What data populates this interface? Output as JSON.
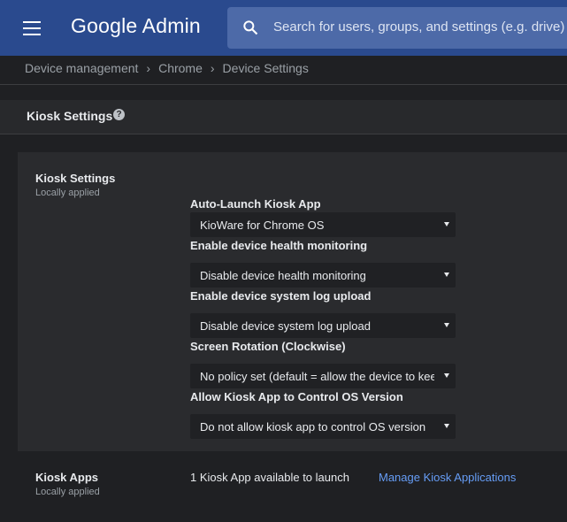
{
  "header": {
    "logo": "Google Admin",
    "search_placeholder": "Search for users, groups, and settings (e.g. drive)"
  },
  "breadcrumb": [
    "Device management",
    "Chrome",
    "Device Settings"
  ],
  "section": {
    "title": "Kiosk Settings"
  },
  "kiosk_settings": {
    "title": "Kiosk Settings",
    "subtitle": "Locally applied",
    "fields": [
      {
        "label": "Auto-Launch Kiosk App",
        "value": "KioWare for Chrome OS"
      },
      {
        "label": "Enable device health monitoring",
        "value": "Disable device health monitoring"
      },
      {
        "label": "Enable device system log upload",
        "value": "Disable device system log upload"
      },
      {
        "label": "Screen Rotation (Clockwise)",
        "value": "No policy set (default = allow the device to keep"
      },
      {
        "label": "Allow Kiosk App to Control OS Version",
        "value": "Do not allow kiosk app to control OS version"
      }
    ]
  },
  "kiosk_apps": {
    "title": "Kiosk Apps",
    "subtitle": "Locally applied",
    "status": "1 Kiosk App available to launch",
    "link": "Manage Kiosk Applications"
  }
}
